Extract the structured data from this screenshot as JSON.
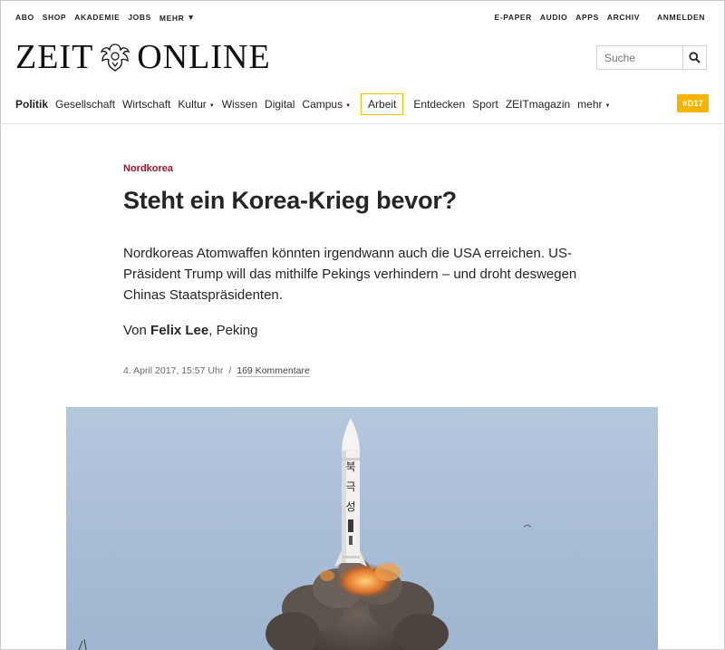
{
  "top_links": [
    "ABO",
    "SHOP",
    "AKADEMIE",
    "JOBS",
    "MEHR"
  ],
  "right_links": [
    "E-PAPER",
    "AUDIO",
    "APPS",
    "ARCHIV"
  ],
  "login": "ANMELDEN",
  "logo": {
    "left": "ZEIT",
    "right": "ONLINE"
  },
  "search": {
    "placeholder": "Suche"
  },
  "nav": {
    "items": [
      "Politik",
      "Gesellschaft",
      "Wirtschaft",
      "Kultur",
      "Wissen",
      "Digital",
      "Campus",
      "Arbeit",
      "Entdecken",
      "Sport",
      "ZEITmagazin",
      "mehr"
    ],
    "active": "Politik",
    "badge": "#D17"
  },
  "article": {
    "kicker": "Nordkorea",
    "headline": "Steht ein Korea-Krieg bevor?",
    "summary": "Nordkoreas Atomwaffen könnten irgendwann auch die USA erreichen. US-Präsident Trump will das mithilfe Pekings verhindern – und droht deswegen Chinas Staatspräsidenten.",
    "byline_prefix": "Von",
    "author": "Felix Lee",
    "location": ", Peking",
    "date": "4. April 2017, 15:57 Uhr",
    "separator": "/",
    "comments": "169 Kommentare"
  },
  "hero": {
    "missile_label": "북극성"
  },
  "colors": {
    "kicker": "#a4142a",
    "accent": "#f5b400",
    "sky": "#a8bfd8"
  }
}
